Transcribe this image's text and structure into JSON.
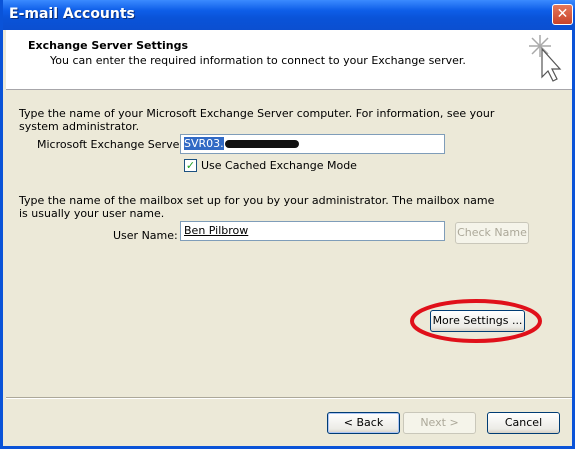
{
  "window": {
    "title": "E-mail Accounts"
  },
  "header": {
    "title": "Exchange Server Settings",
    "subtitle": "You can enter the required information to connect to your Exchange server."
  },
  "server_section": {
    "instructions_line1": "Type the name of your Microsoft Exchange Server computer. For information, see your",
    "instructions_line2": "system administrator.",
    "server_label": "Microsoft Exchange Server:",
    "server_value": "SVR03.",
    "cached_mode_label": "Use Cached Exchange Mode",
    "cached_mode_checked": true
  },
  "mailbox_section": {
    "instructions_line1": "Type the name of the mailbox set up for you by your administrator. The mailbox name",
    "instructions_line2": "is usually your user name.",
    "username_label": "User Name:",
    "username_value": "Ben Pilbrow",
    "check_name_label": "Check Name"
  },
  "more_settings_label": "More Settings ...",
  "footer": {
    "back_label": "< Back",
    "next_label": "Next >",
    "cancel_label": "Cancel"
  },
  "colors": {
    "titlebar": "#0a53d8",
    "dialog_bg": "#ece9d8",
    "highlight_oval": "#e0101a"
  },
  "icons": {
    "close": "close-icon",
    "wizard": "wizard-sparkle-cursor-icon",
    "check": "checkmark-icon"
  }
}
